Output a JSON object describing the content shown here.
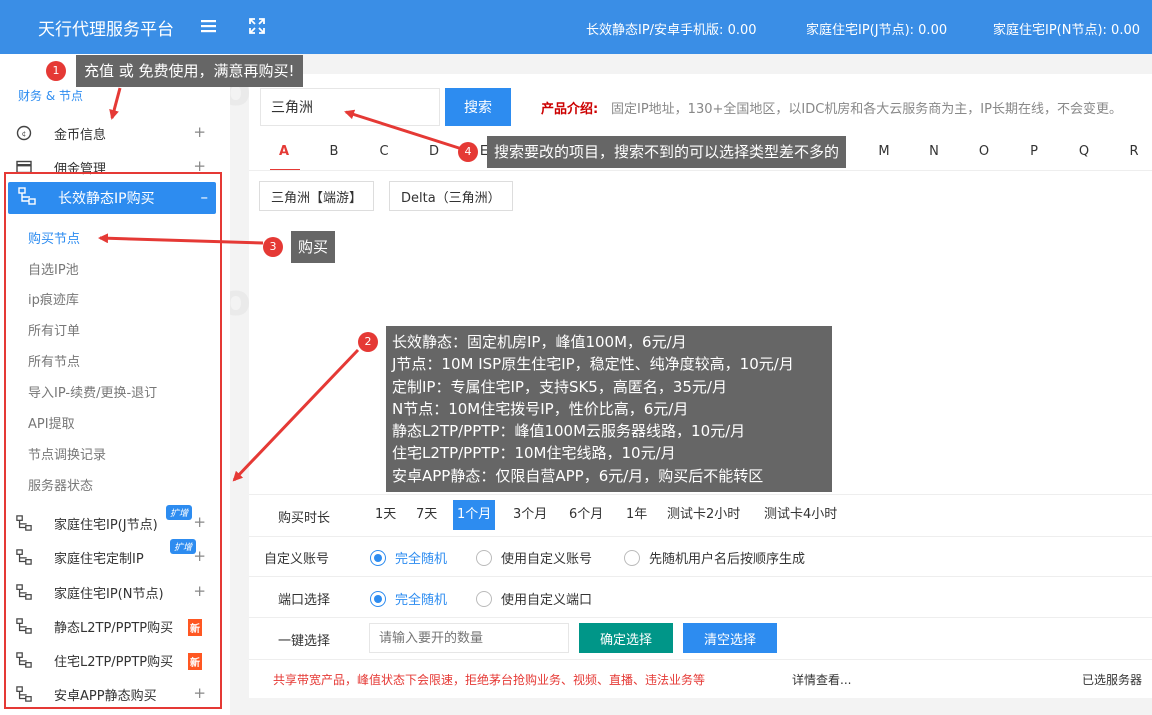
{
  "header": {
    "brand": "天行代理服务平台",
    "menu_icon": "hamburger-icon",
    "expand_icon": "fullscreen-icon",
    "stats": [
      "长效静态IP/安卓手机版: 0.00",
      "家庭住宅IP(J节点): 0.00",
      "家庭住宅IP(N节点): 0.00"
    ]
  },
  "sidebar": {
    "group_label": "财务 & 节点",
    "items_top": [
      {
        "label": "金币信息",
        "icon": "coin-icon"
      },
      {
        "label": "佣金管理",
        "icon": "card-icon"
      }
    ],
    "active": {
      "label": "长效静态IP购买",
      "icon": "network-icon"
    },
    "sub_items": [
      "购买节点",
      "自选IP池",
      "ip痕迹库",
      "所有订单",
      "所有节点",
      "导入IP-续费/更换-退订",
      "API提取",
      "节点调换记录",
      "服务器状态"
    ],
    "items_bottom": [
      {
        "label": "家庭住宅IP(J节点)",
        "badge": "扩增"
      },
      {
        "label": "家庭住宅定制IP",
        "badge": "扩增"
      },
      {
        "label": "家庭住宅IP(N节点)",
        "badge": ""
      },
      {
        "label": "静态L2TP/PPTP购买",
        "badge": "新"
      },
      {
        "label": "住宅L2TP/PPTP购买",
        "badge": "新"
      },
      {
        "label": "安卓APP静态购买",
        "badge": ""
      }
    ]
  },
  "search": {
    "value": "三角洲",
    "button": "搜索"
  },
  "intro": {
    "label": "产品介绍:",
    "text": "固定IP地址，130+全国地区，以IDC机房和各大云服务商为主，IP长期在线，不会变更。"
  },
  "letters": [
    "A",
    "B",
    "C",
    "D",
    "E",
    "M",
    "N",
    "O",
    "P",
    "Q",
    "R"
  ],
  "products": [
    "三角洲【端游】",
    "Delta（三角洲）"
  ],
  "duration": {
    "label": "购买时长",
    "options": [
      "1天",
      "7天",
      "1个月",
      "3个月",
      "6个月",
      "1年",
      "测试卡2小时",
      "测试卡4小时"
    ],
    "selected": "1个月"
  },
  "account": {
    "label": "自定义账号",
    "options": [
      "完全随机",
      "使用自定义账号",
      "先随机用户名后按顺序生成"
    ]
  },
  "port": {
    "label": "端口选择",
    "options": [
      "完全随机",
      "使用自定义端口"
    ]
  },
  "one_click": {
    "label": "一键选择",
    "placeholder": "请输入要开的数量",
    "confirm": "确定选择",
    "clear": "清空选择"
  },
  "footer": {
    "warning": "共享带宽产品，峰值状态下会限速，拒绝茅台抢购业务、视频、直播、违法业务等",
    "details": "详情查看...",
    "selected": "已选服务器"
  },
  "callouts": {
    "c1": {
      "num": "1",
      "text": "充值 或 免费使用，满意再购买!"
    },
    "c2": {
      "num": "2",
      "lines": [
        "长效静态：固定机房IP，峰值100M，6元/月",
        "J节点：10M ISP原生住宅IP，稳定性、纯净度较高，10元/月",
        "定制IP：专属住宅IP，支持SK5，高匿名，35元/月",
        "N节点：10M住宅拨号IP，性价比高，6元/月",
        "静态L2TP/PPTP：峰值100M云服务器线路，10元/月",
        "住宅L2TP/PPTP：10M住宅线路，10元/月",
        "安卓APP静态：仅限自营APP，6元/月，购买后不能转区"
      ]
    },
    "c3": {
      "num": "3",
      "text": "购买"
    },
    "c4": {
      "num": "4",
      "text": "搜索要改的项目，搜索不到的可以选择类型差不多的"
    }
  },
  "watermark": "iP0168.com",
  "colors": {
    "primary": "#2d8cf0",
    "header": "#3a8ee6",
    "danger": "#e53935",
    "confirm": "#009688",
    "callout": "#666666"
  }
}
